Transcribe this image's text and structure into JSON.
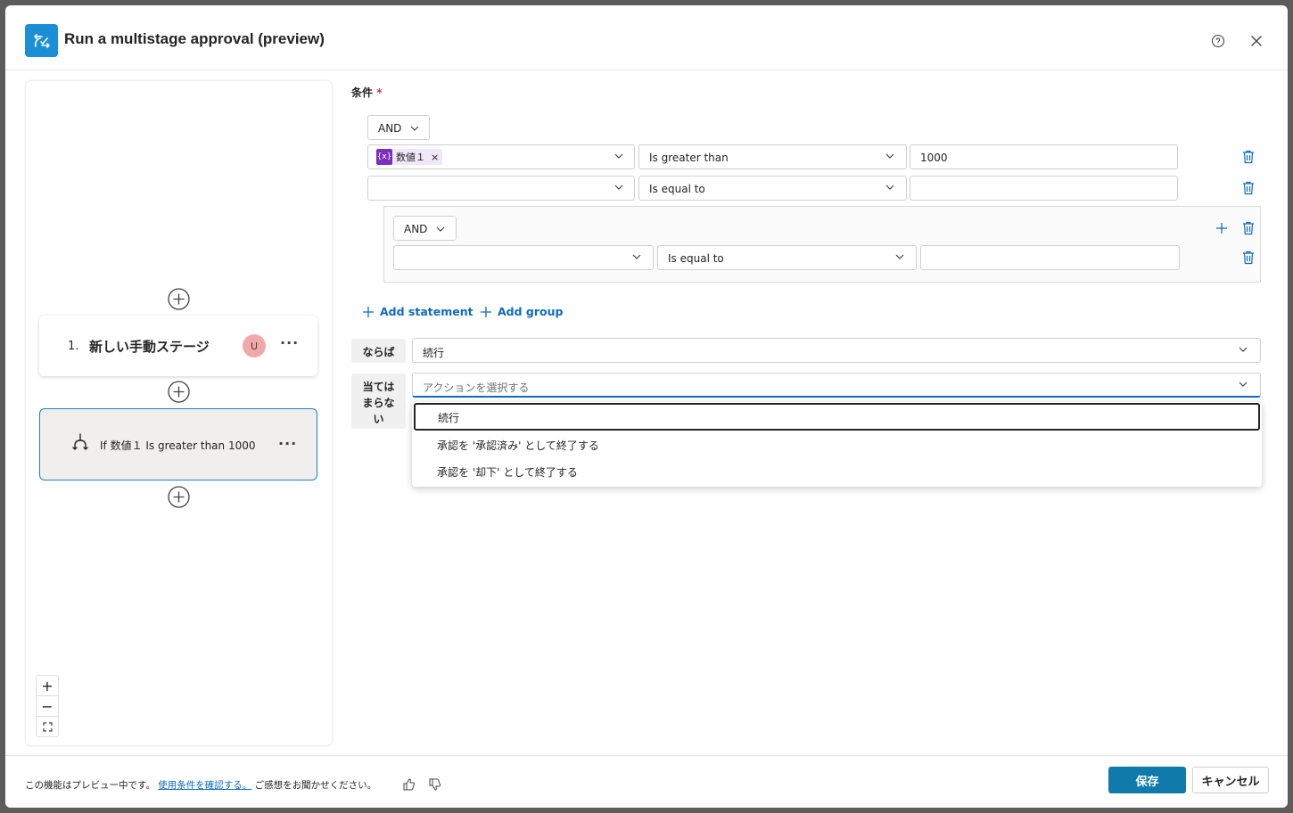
{
  "header": {
    "title": "Run a multistage approval (preview)",
    "app_icon": "approval-icon",
    "help_icon": "help-icon",
    "close_icon": "close-icon"
  },
  "flow": {
    "stage": {
      "number": "1.",
      "name": "新しい手動ステージ",
      "avatar": "U",
      "more": "···"
    },
    "condition": {
      "text": "If 数値１ Is greater than 1000",
      "icon": "branch-icon",
      "more": "···"
    },
    "zoom": {
      "in": "+",
      "out": "−",
      "fit": "⛶"
    }
  },
  "conditions": {
    "label": "条件",
    "required_mark": "*",
    "root_operator": "AND",
    "rows": [
      {
        "field_chip": "数値１",
        "chip_icon": "{x}",
        "operator": "Is greater than",
        "value": "1000"
      },
      {
        "field_chip": "",
        "operator": "Is equal to",
        "value": ""
      }
    ],
    "group": {
      "operator": "AND",
      "rows": [
        {
          "field_chip": "",
          "operator": "Is equal to",
          "value": ""
        }
      ]
    },
    "add_statement": "Add statement",
    "add_group": "Add group"
  },
  "then": {
    "label": "ならば",
    "value": "続行"
  },
  "else": {
    "label": "当てはまらない",
    "placeholder": "アクションを選択する",
    "options": [
      "続行",
      "承認を '承認済み' として終了する",
      "承認を '却下' として終了する"
    ]
  },
  "footer": {
    "text_before": "この機能はプレビュー中です。",
    "link": "使用条件を確認する。",
    "text_after": " ご感想をお聞かせください。",
    "save": "保存",
    "cancel": "キャンセル"
  }
}
